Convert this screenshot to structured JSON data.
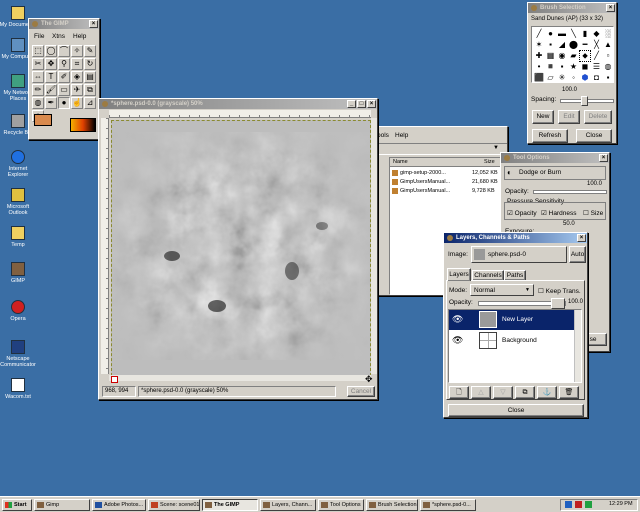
{
  "desktop_icons": [
    {
      "label": "My Documents",
      "icon": "folder-icon"
    },
    {
      "label": "My Computer",
      "icon": "computer-icon"
    },
    {
      "label": "My Network Places",
      "icon": "network-icon"
    },
    {
      "label": "Recycle Bin",
      "icon": "recycle-bin-icon"
    },
    {
      "label": "Internet Explorer",
      "icon": "ie-icon"
    },
    {
      "label": "Microsoft Outlook",
      "icon": "outlook-icon"
    },
    {
      "label": "Temp",
      "icon": "folder-icon"
    },
    {
      "label": "GIMP",
      "icon": "gimp-icon"
    },
    {
      "label": "Opera",
      "icon": "opera-icon"
    },
    {
      "label": "Netscape Communicator",
      "icon": "netscape-icon"
    },
    {
      "label": "Wacom.txt",
      "icon": "text-file-icon"
    }
  ],
  "gimp_toolbox": {
    "title": "The GIMP",
    "menu": [
      "File",
      "Xtns",
      "Help"
    ],
    "fg_color": "#d98a4e",
    "bg_color": "#ffffff"
  },
  "image_window": {
    "title": "*sphere.psd-0.0 (grayscale) 50%",
    "coords": "968, 994",
    "status": "*sphere.psd-0.0 (grayscale) 50%",
    "cancel_label": "Cancel"
  },
  "explorer": {
    "menu": [
      "ools",
      "Help"
    ],
    "columns": [
      "Name",
      "Size"
    ],
    "files": [
      {
        "name": "gimp-setup-2000...",
        "size": "12,052 KB"
      },
      {
        "name": "GimpUsersManual...",
        "size": "21,680 KB"
      },
      {
        "name": "GimpUsersManual...",
        "size": "9,728 KB"
      }
    ]
  },
  "brush_selection": {
    "title": "Brush Selection",
    "brush_name": "Sand Dunes (AP)  (33 x 32)",
    "spacing_label": "Spacing:",
    "spacing_value": "100.0",
    "buttons": {
      "new": "New",
      "edit": "Edit",
      "delete": "Delete",
      "refresh": "Refresh",
      "close": "Close"
    }
  },
  "tool_options": {
    "title": "Tool Options",
    "tool": "Dodge or Burn",
    "opacity_label": "Opacity:",
    "opacity_value": "100.0",
    "pressure_label": "Pressure Sensitivity",
    "opt_opacity": "Opacity",
    "opt_hardness": "Hardness",
    "opt_size": "Size",
    "exposure_label": "Exposure:",
    "exposure_value": "50.0",
    "close_fragment": "se"
  },
  "layers": {
    "title": "Layers, Channels & Paths",
    "image_label": "Image:",
    "image_value": "sphere.psd-0",
    "auto_label": "Auto",
    "tabs": [
      "Layers",
      "Channels",
      "Paths"
    ],
    "mode_label": "Mode:",
    "mode_value": "Normal",
    "keep_trans": "Keep Trans.",
    "opacity_label": "Opacity:",
    "opacity_value": "100.0",
    "rows": [
      "New Layer",
      "Background"
    ],
    "close_label": "Close"
  },
  "taskbar": {
    "start": "Start",
    "tasks": [
      "Gimp",
      "Adobe Photos...",
      "Scene: scene01",
      "The GIMP",
      "Layers, Chann...",
      "Tool Options",
      "Brush Selection",
      "*sphere.psd-0..."
    ],
    "clock": "12:29 PM"
  }
}
